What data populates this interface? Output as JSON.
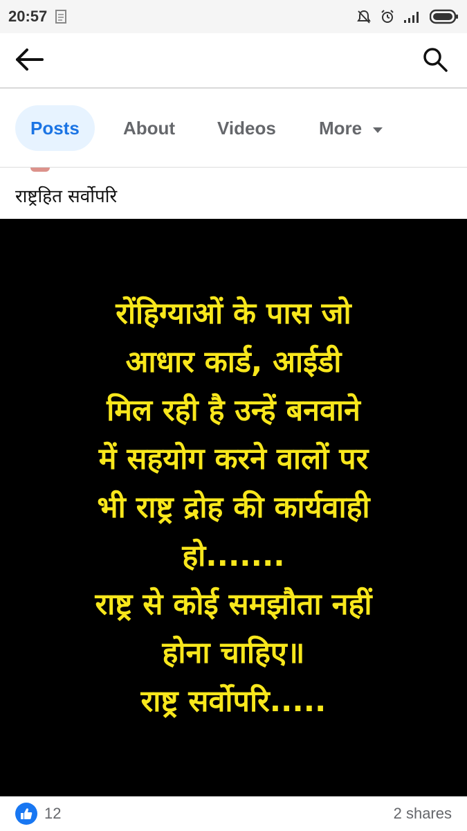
{
  "status_bar": {
    "time": "20:57",
    "icons": [
      "notes-icon",
      "mute-icon",
      "alarm-icon",
      "signal-icon",
      "battery-icon"
    ]
  },
  "header": {
    "back_icon": "arrow-left-icon",
    "search_icon": "search-icon"
  },
  "tabs": [
    {
      "label": "Posts",
      "active": true
    },
    {
      "label": "About",
      "active": false
    },
    {
      "label": "Videos",
      "active": false
    },
    {
      "label": "More",
      "active": false,
      "icon": "caret-down-icon"
    }
  ],
  "post": {
    "page_name": "राष्ट्रहित सर्वोपरि",
    "image_text_lines": [
      "रोंहिग्याओं के पास जो",
      "आधार कार्ड, आईडी",
      "मिल रही है उन्हें बनवाने",
      "में सहयोग करने वालों पर",
      "भी राष्ट्र द्रोह की कार्यवाही",
      "हो.......",
      "राष्ट्र से कोई समझौता नहीं",
      "होना चाहिए॥",
      "राष्ट्र सर्वोपरि....."
    ],
    "image_text_color": "#f8e71c",
    "likes": "12",
    "shares": "2 shares"
  },
  "colors": {
    "accent": "#1b74e4",
    "active_tab_bg": "#e7f3ff",
    "like_blue": "#1877f2"
  }
}
